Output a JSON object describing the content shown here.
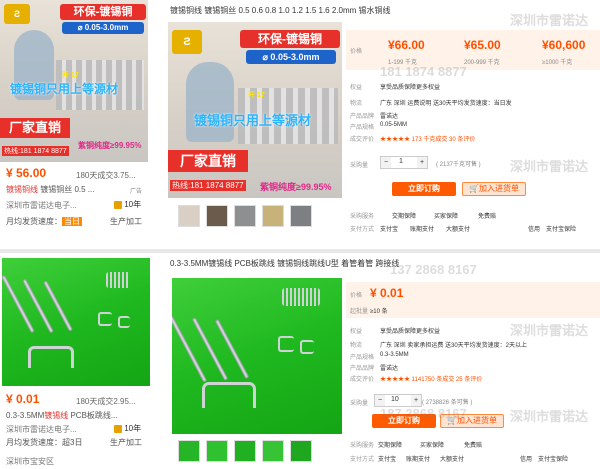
{
  "top": {
    "title": "镀锡铜线 镀锡铜丝 0.5 0.6 0.8 1.0 1.2 1.5 1.6 2.0mm 锡水铜线",
    "banner_eco": "环保-镀锡铜",
    "banner_spec": "⌀ 0.05-3.0mm",
    "overlay_slogan": "镀锡铜只用上等源材",
    "overlay_factory": "厂家直销",
    "overlay_phone": "热线:181 1874 8877",
    "overlay_purity": "紫铜纯度≥99.95%",
    "overlay_seller_small": "开 17",
    "left_card": {
      "price": "¥ 56.00",
      "sold": "180天成交3.75...",
      "title_red": "镀锡铜线",
      "title_rest": " 镀锡铜丝 0.5 ...",
      "ad": "广告",
      "seller": "深圳市雷诺达电子...",
      "years": "10年",
      "ship_label": "月均发货速度：",
      "ship_value": "当日",
      "type": "生产加工"
    },
    "prices": [
      {
        "value": "¥66.00",
        "range": "1-199 千克"
      },
      {
        "value": "¥65.00",
        "range": "200-999 千克"
      },
      {
        "value": "¥60,600",
        "range": "≥1000 千克"
      }
    ],
    "price_label": "价格",
    "rows": [
      {
        "label": "权益",
        "value": "享受品质保障更多权益"
      },
      {
        "label": "物流",
        "value": "广东 深圳   运费说明     送30天平均发货速度：当日发"
      },
      {
        "label": "产品品牌",
        "value": "雷诺达"
      },
      {
        "label": "产品规格",
        "value": "0.05-5MM"
      },
      {
        "label": "成交评价",
        "value": "★★★★★    173 千克成交    30 条评价"
      }
    ],
    "qty_label": "采购量",
    "qty_value": "1",
    "stock": "( 2137千克可售 )",
    "buy": "立即订购",
    "cart": "加入进货单",
    "services_label": "采购服务",
    "services": [
      "交期保障",
      "买家保障",
      "免费赔",
      "支付方式",
      "支付宝",
      "账期支付",
      "大额支付",
      "信用",
      "支付宝保险"
    ]
  },
  "bottom": {
    "title": "0.3-3.5MM镀锡线 PCB板跳线 镀锡铜线跳线U型 着管着管 跨接线",
    "left_card": {
      "price": "¥ 0.01",
      "sold": "180天成交2.95...",
      "title_a": "0.3-3.5MM",
      "title_red": "镀锡线",
      "title_b": " PCB板跳线...",
      "seller": "深圳市雷诺达电子...",
      "years": "10年",
      "ship_label": "月均发货速度：",
      "ship_value": "超3日",
      "type": "生产加工",
      "location": "深圳市宝安区"
    },
    "price_label": "价格",
    "price": "¥ 0.01",
    "start_label": "起批量",
    "start_value": "≥10 条",
    "rows": [
      {
        "label": "权益",
        "value": "享受品质保障更多权益"
      },
      {
        "label": "物流",
        "value": "广东 深圳   卖家承担运费   送30天平均发货速度：2天以上"
      },
      {
        "label": "产品规格",
        "value": "0.3-3.5MM"
      },
      {
        "label": "产品品牌",
        "value": "雷诺达"
      },
      {
        "label": "成交评价",
        "value": "★★★★★    1141750 条成交    25 条评价"
      }
    ],
    "qty_label": "采购量",
    "qty_value": "10",
    "stock": "( 2738826 条可售 )",
    "buy": "立即订购",
    "cart": "加入进货单",
    "services_label": "采购服务",
    "services": [
      "交期保障",
      "买家保障",
      "免费赔",
      "支付方式",
      "支付宝",
      "账期支付",
      "大额支付",
      "信用",
      "支付宝保险"
    ]
  },
  "watermarks": [
    "深圳市雷诺达",
    "181 1874 8877",
    "深圳市雷诺达",
    "137 2868 8167",
    "深圳市雷诺达",
    "187 2868 8167",
    "深圳市雷诺达"
  ],
  "colors": {
    "accent": "#ff5000",
    "banner_red": "#e8302a",
    "green_bg": "#21b821"
  }
}
